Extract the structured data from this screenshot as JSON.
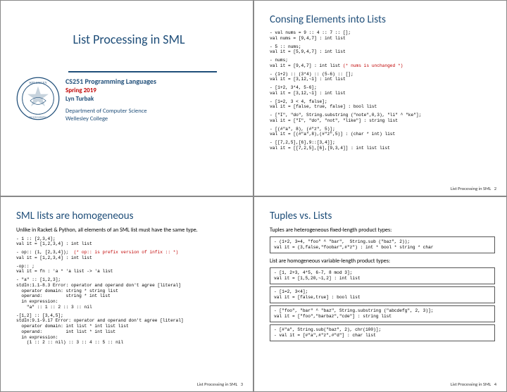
{
  "footer_base": "List Processing in SML",
  "slide1": {
    "title": "List Processing in SML",
    "course": "CS251 Programming Languages",
    "term": "Spring 2019",
    "prof": "Lyn Turbak",
    "dept": "Department of Computer Science",
    "college": "Wellesley College"
  },
  "slide2": {
    "title": "Consing Elements into Lists",
    "c1": "- val nums = 9 :: 4 :: 7 :: [];\nval nums = [9,4,7] : int list",
    "c2": "- 5 :: nums;\nval it = [5,9,4,7] : int list",
    "c3a": "- nums;\nval it = [9,4,7] : int list ",
    "c3b": "(* nums is unchanged *)",
    "c4": "- (1+2) :: (3*4) :: (5-6) :: [];\nval it = [3,12,~1] : int list",
    "c5": "- [1+2, 3*4, 5-6];\nval it = [3,12,~1] : int list",
    "c6": "- [1=2, 3 < 4, false];\nval it = [false, true, false] : bool list",
    "c7": "- [\"I\", \"do\", String.substring (\"note\",0,3), \"li\" ^ \"ke\"];\nval it = [\"I\", \"do\", \"not\", \"like\"] : string list",
    "c8": "- [(#\"a\", 8), (#\"z\", 5)];\nval it = [(#\"a\",8),(#\"z\",5)] : (char * int) list",
    "c9": "- [[7,2,5],[6],9::[3,4]];\nval it = [[7,2,5],[6],[9,3,4]] : int list list",
    "pageno": "2"
  },
  "slide3": {
    "title": "SML lists are homogeneous",
    "intro": "Unlike in Racket & Python, all elements of an SML list must have the same type.",
    "c1": "- 1 :: [2,3,4];\nval it = [1,2,3,4] : int list",
    "c2a": "- op:: (1, [2,3,4]);  ",
    "c2b": "(* op:: is prefix version of infix :: *)",
    "c2c": "\nval it = [1,2,3,4] : int list",
    "c3": "-op:: ;\nval it = fn : 'a * 'a list -> 'a list",
    "c4": "- \"a\" :: [1,2,3];\nstdIn:1.1-8.3 Error: operator and operand don't agree [literal]\n  operator domain: string * string list\n  operand:         string * int list\n  in expression:\n    \"a\" :: 1 :: 2 :: 3 :: nil",
    "c5": "-[1,2] :: [3,4,5];\nstdIn:9.1-9.17 Error: operator and operand don't agree [literal]\n  operator domain: int list * int list list\n  operand:         int list * int list\n  in expression:\n    (1 :: 2 :: nil) :: 3 :: 4 :: 5 :: nil",
    "pageno": "3"
  },
  "slide4": {
    "title": "Tuples vs. Lists",
    "t1": "Tuples are heterogeneous fixed-length product types:",
    "b1": "- (1+2, 3=4, \"foo\" ^ \"bar\",  String.sub (\"baz\", 2));\nval it = (3,false,\"foobar\",#\"z\") : int * bool * string * char",
    "t2": "List are homogeneous variable-length product types:",
    "b2": "- [1, 2+3, 4*5, 6-7, 8 mod 3];\nval it = [1,5,20,~1,2] : int list",
    "b3": "- [1=2, 3<4];\nval it = [false,true] : bool list",
    "b4": "- [\"foo\", \"bar\" ^ \"baz\", String.substring (\"abcdefg\", 2, 3)];\nval it = [\"foo\",\"barbaz\",\"cde\"] : string list",
    "b5": "- [#\"a\", String.sub(\"baz\", 2), chr(100)];\n- val it = [#\"a\",#\"z\",#\"d\"] : char list",
    "pageno": "4"
  }
}
